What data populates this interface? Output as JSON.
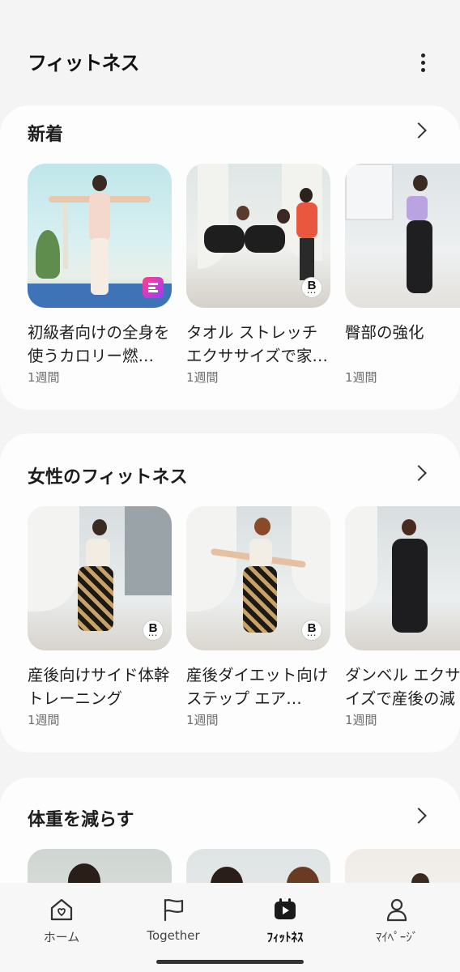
{
  "header": {
    "title": "フィットネス",
    "more_icon": "more-vertical-icon"
  },
  "sections": [
    {
      "title": "新着",
      "items": [
        {
          "title": "初級者向けの全身を使うカロリー燃…",
          "meta": "1週間",
          "badge": "E"
        },
        {
          "title": "タオル ストレッチ エクササイズで家…",
          "meta": "1週間",
          "badge": "B"
        },
        {
          "title": "臀部の強化",
          "meta": "1週間",
          "badge": ""
        }
      ]
    },
    {
      "title": "女性のフィットネス",
      "items": [
        {
          "title": "産後向けサイド体幹トレーニング",
          "meta": "1週間",
          "badge": "B"
        },
        {
          "title": "産後ダイエット向けステップ エア…",
          "meta": "1週間",
          "badge": "B"
        },
        {
          "title": "ダンベル エクササイズで産後の減",
          "meta": "1週間",
          "badge": ""
        }
      ]
    },
    {
      "title": "体重を減らす",
      "items": []
    }
  ],
  "nav": {
    "items": [
      {
        "label": "ホーム",
        "icon": "home-heart-icon"
      },
      {
        "label": "Together",
        "icon": "flag-icon"
      },
      {
        "label": "ﾌｨｯﾄﾈｽ",
        "icon": "fitness-play-icon"
      },
      {
        "label": "ﾏｲﾍﾟｰｼﾞ",
        "icon": "profile-icon"
      }
    ],
    "active": "ﾌｨｯﾄﾈｽ"
  },
  "colors": {
    "background": "#f4f4f4",
    "card": "#fdfdfd",
    "text": "#1e1e1e",
    "meta": "#6e6e6e"
  }
}
